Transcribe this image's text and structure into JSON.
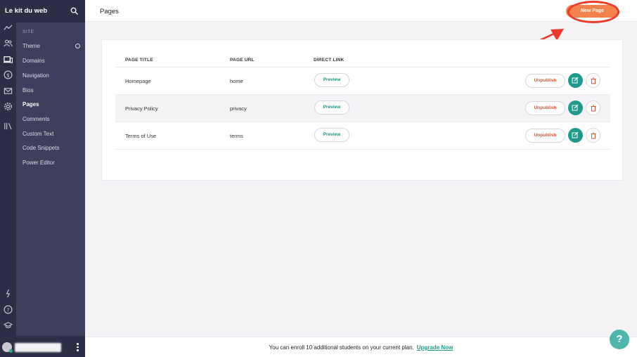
{
  "sidebar": {
    "brand": "Le kit du web",
    "section_label": "SITE",
    "items": [
      {
        "label": "Theme"
      },
      {
        "label": "Domains"
      },
      {
        "label": "Navigation"
      },
      {
        "label": "Bios"
      },
      {
        "label": "Pages",
        "active": true
      },
      {
        "label": "Comments"
      },
      {
        "label": "Custom Text"
      },
      {
        "label": "Code Snippets"
      },
      {
        "label": "Power Editor"
      }
    ],
    "rail_icons": [
      "analytics-icon",
      "users-icon",
      "devices-icon",
      "dollar-icon",
      "mail-icon",
      "gear-icon",
      "library-icon",
      "lightning-icon",
      "help-circle-icon",
      "graduation-cap-icon"
    ]
  },
  "header": {
    "title": "Pages",
    "new_page_label": "New Page"
  },
  "table": {
    "columns": [
      "PAGE TITLE",
      "PAGE URL",
      "DIRECT LINK"
    ],
    "rows": [
      {
        "title": "Homepage",
        "url": "home",
        "preview": "Preview",
        "unpublish": "Unpublish"
      },
      {
        "title": "Privacy Policy",
        "url": "privacy",
        "preview": "Preview",
        "unpublish": "Unpublish"
      },
      {
        "title": "Terms of Use",
        "url": "terms",
        "preview": "Preview",
        "unpublish": "Unpublish"
      }
    ]
  },
  "footer": {
    "message": "You can enroll 10 additional students on your current plan.",
    "upgrade_label": "Upgrade Now"
  },
  "help": {
    "label": "?"
  },
  "colors": {
    "sidebar": "#3d3f5c",
    "rail": "#2c2e45",
    "accent_orange": "#f3814c",
    "accent_teal": "#1e9b8d",
    "danger": "#e0522c",
    "annotation_red": "#ef3a2a"
  }
}
